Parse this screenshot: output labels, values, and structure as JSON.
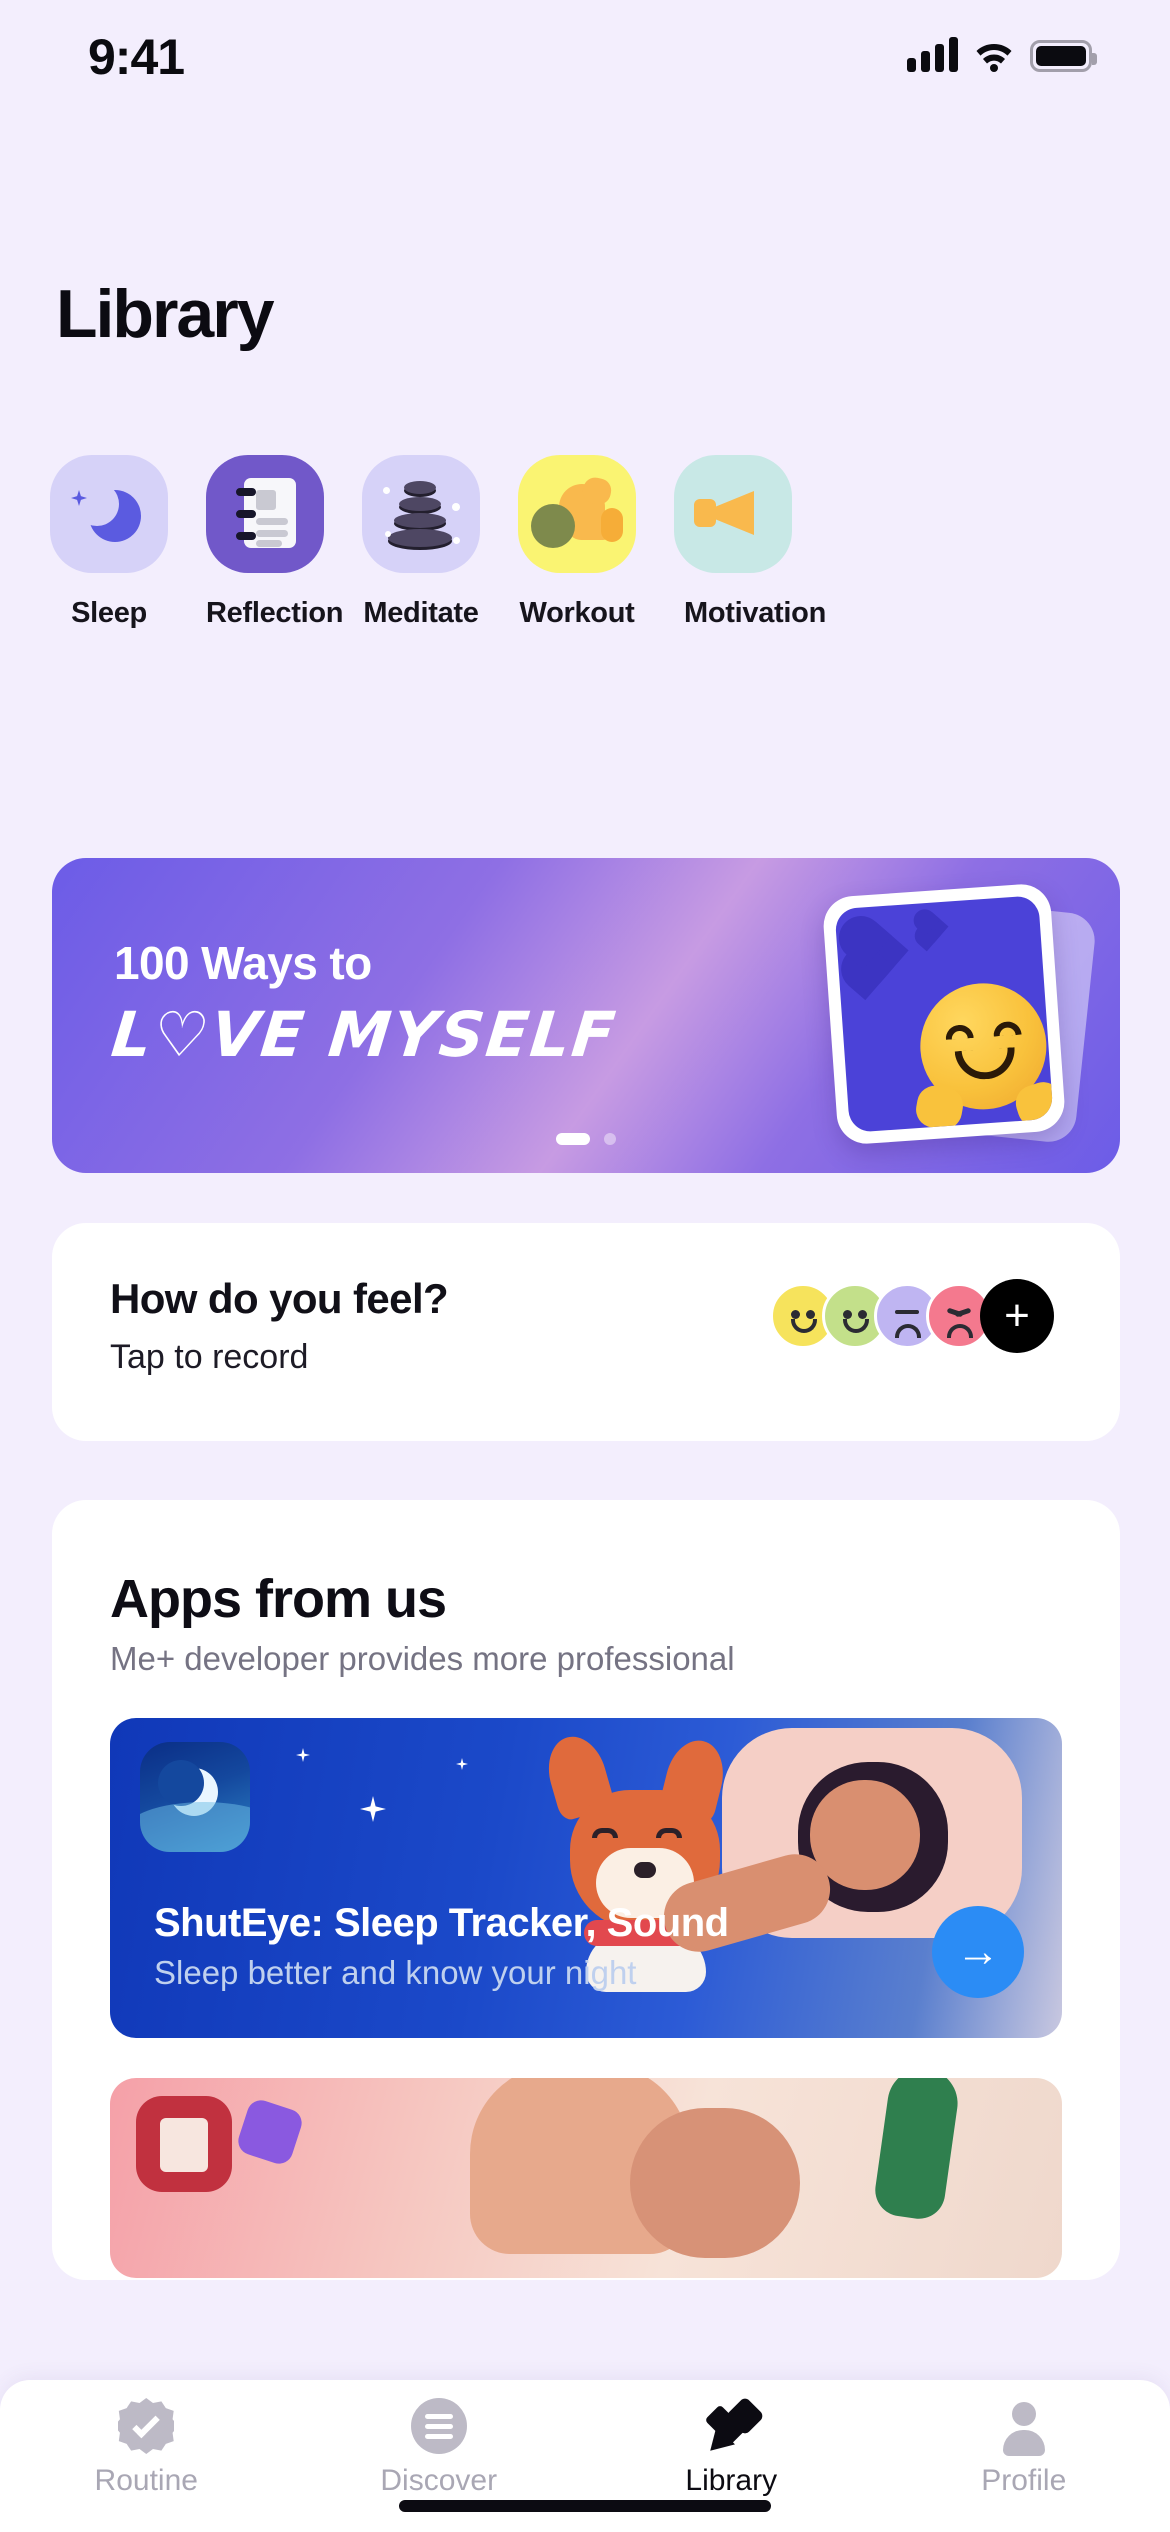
{
  "status_bar": {
    "time": "9:41",
    "cellular_icon": "cellular-bars-icon",
    "wifi_icon": "wifi-icon",
    "battery_icon": "battery-full-icon"
  },
  "header": {
    "title": "Library"
  },
  "categories": [
    {
      "label": "Sleep",
      "icon": "crescent-moon-icon",
      "tile_color": "#D6D2F8",
      "accent": "#5B5BE0"
    },
    {
      "label": "Reflection",
      "icon": "notebook-icon",
      "tile_color": "#7158C9",
      "accent": "#F7F7FA"
    },
    {
      "label": "Meditate",
      "icon": "zen-stones-icon",
      "tile_color": "#D6D2F8",
      "accent": "#4E4763"
    },
    {
      "label": "Workout",
      "icon": "flexed-biceps-icon",
      "tile_color": "#FAF472",
      "accent": "#F9B94D"
    },
    {
      "label": "Motivation",
      "icon": "megaphone-icon",
      "tile_color": "#C8E8E6",
      "accent": "#F9B94D"
    }
  ],
  "promo_banner": {
    "line1": "100 Ways to",
    "line2": "L♡VE MYSELF",
    "card_emoji": "hugging-face-emoji",
    "pages": 2,
    "active_page": 1,
    "gradient_from": "#6C5CE7",
    "gradient_to": "#C79BE3"
  },
  "feel_card": {
    "title": "How do you feel?",
    "subtitle": "Tap to record",
    "moods": [
      {
        "name": "winking-happy-face",
        "color": "#F6E35C"
      },
      {
        "name": "smiling-face",
        "color": "#C3E08A"
      },
      {
        "name": "sad-face",
        "color": "#BFB5F2"
      },
      {
        "name": "angry-face",
        "color": "#F4798E"
      }
    ],
    "add_button": {
      "label": "+",
      "color": "#000000"
    }
  },
  "apps_section": {
    "title": "Apps from us",
    "subtitle": "Me+ developer provides more professional",
    "apps": [
      {
        "name": "ShutEye: Sleep Tracker, Sound",
        "description": "Sleep better and know your night",
        "icon": "moon-night-app-icon",
        "cta_icon": "arrow-right-icon",
        "cta_label": "→",
        "accent": "#2B8CF5"
      },
      {
        "name": "",
        "description": "",
        "icon": "book-app-icon",
        "accent": "#C1313F"
      }
    ]
  },
  "tab_bar": {
    "items": [
      {
        "label": "Routine",
        "icon": "badge-check-icon",
        "active": false
      },
      {
        "label": "Discover",
        "icon": "discover-list-icon",
        "active": false
      },
      {
        "label": "Library",
        "icon": "highlighter-icon",
        "active": true
      },
      {
        "label": "Profile",
        "icon": "person-icon",
        "active": false
      }
    ]
  }
}
